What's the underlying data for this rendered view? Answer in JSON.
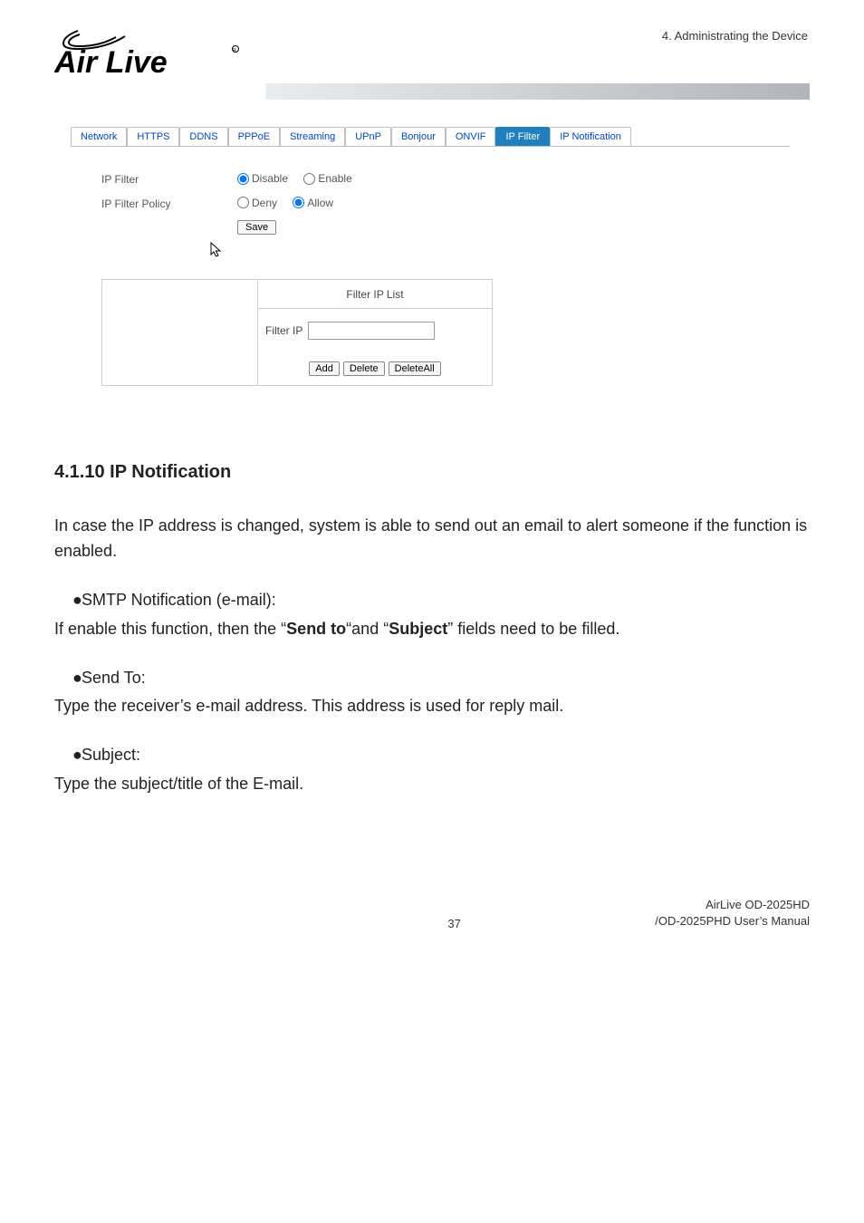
{
  "header": {
    "chapter": "4. Administrating the Device",
    "logo_text": "Air Live"
  },
  "tabs": [
    "Network",
    "HTTPS",
    "DDNS",
    "PPPoE",
    "Streaming",
    "UPnP",
    "Bonjour",
    "ONVIF",
    "IP Filter",
    "IP Notification"
  ],
  "active_tab": "IP Filter",
  "form": {
    "ip_filter_label": "IP Filter",
    "ip_filter_policy_label": "IP Filter Policy",
    "disable": "Disable",
    "enable": "Enable",
    "deny": "Deny",
    "allow": "Allow",
    "save": "Save",
    "filter_list_title": "Filter IP List",
    "filter_ip_label": "Filter IP",
    "filter_ip_value": "",
    "filter_ip_placeholder": "",
    "add": "Add",
    "delete": "Delete",
    "delete_all": "DeleteAll"
  },
  "doc": {
    "heading": "4.1.10  IP Notification",
    "intro": "In case the IP address is changed, system is able to send out an email to alert someone if the function is enabled.",
    "b1_title": "SMTP Notification (e-mail):",
    "b1_body_pre": "If enable this function, then the “",
    "b1_body_bold1": "Send to",
    "b1_body_mid": "“and “",
    "b1_body_bold2": "Subject",
    "b1_body_post": "” fields need to be filled.",
    "b2_title": "Send To:",
    "b2_body": "Type the receiver’s e-mail address. This address is used for reply mail.",
    "b3_title": "Subject:",
    "b3_body": "Type the subject/title of the E-mail."
  },
  "footer": {
    "page_number": "37",
    "model1": "AirLive OD-2025HD",
    "model2": "/OD-2025PHD User’s Manual"
  }
}
